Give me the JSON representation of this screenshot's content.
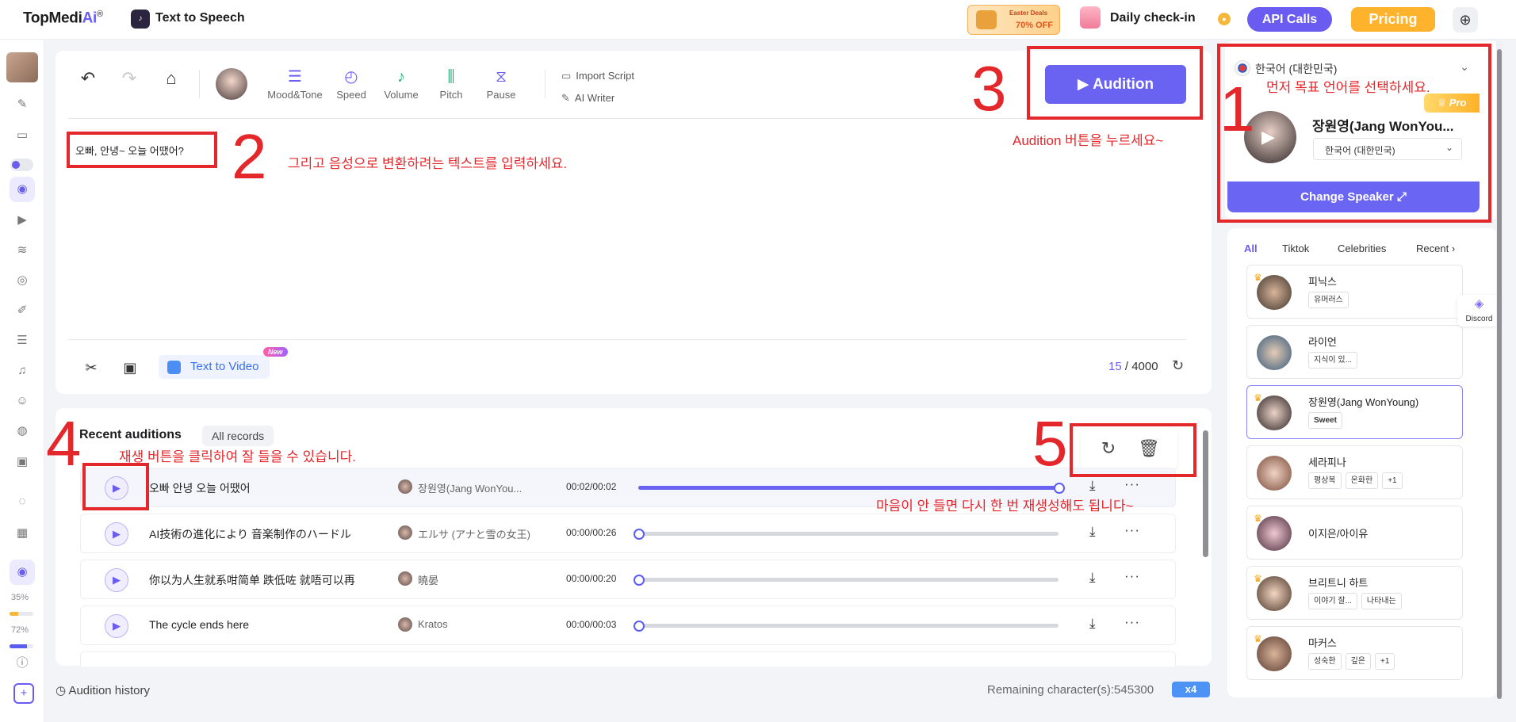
{
  "topbar": {
    "brand": "TopMedi",
    "brand_ai": "Ai",
    "brand_reg": "®",
    "tts_title": "Text to Speech",
    "promo_line1": "Easter Deals",
    "promo_line2": "70% OFF",
    "checkin": "Daily check-in",
    "api_calls": "API Calls",
    "pricing": "Pricing"
  },
  "rail": {
    "pct1": "35%",
    "pct1_value": 0.35,
    "pct2": "72%",
    "pct2_value": 0.72
  },
  "toolbar": {
    "tools": [
      "Mood&Tone",
      "Speed",
      "Volume",
      "Pitch",
      "Pause"
    ],
    "import_script": "Import Script",
    "ai_writer": "AI Writer",
    "audition": "Audition"
  },
  "editor": {
    "text": "오빠, 안녕~ 오늘 어땠어?",
    "text_to_video": "Text to Video",
    "new_badge": "New",
    "chars_used": "15",
    "chars_max": "/ 4000"
  },
  "recent": {
    "title": "Recent auditions",
    "all_records": "All records",
    "rows": [
      {
        "text": "오빠 안녕 오늘 어땠어",
        "speaker": "장원영(Jang WonYou...",
        "time": "00:02/00:02",
        "progress": 1.0
      },
      {
        "text": "AI技術の進化により 音楽制作のハードル",
        "speaker": "エルサ (アナと雪の女王)",
        "time": "00:00/00:26",
        "progress": 0.0
      },
      {
        "text": "你以为人生就系咁简单 跌低咗 就唔可以再",
        "speaker": "曉晏",
        "time": "00:00/00:20",
        "progress": 0.0
      },
      {
        "text": "The cycle ends here",
        "speaker": "Kratos",
        "time": "00:00/00:03",
        "progress": 0.0
      }
    ],
    "history": "Audition history",
    "remaining": "Remaining character(s):545300",
    "multiplier": "x4"
  },
  "right": {
    "language": "한국어 (대한민국)",
    "pro": "Pro",
    "speaker_name": "장원영(Jang WonYou...",
    "speaker_lang": "한국어 (대한민국)",
    "change_speaker": "Change Speaker",
    "tabs": [
      "All",
      "Tiktok",
      "Celebrities",
      "Recent"
    ],
    "voices": [
      {
        "name": "피닉스",
        "tags": [
          "유머러스"
        ]
      },
      {
        "name": "라이언",
        "tags": [
          "지식이 있..."
        ]
      },
      {
        "name": "장원영(Jang WonYoung)",
        "tags": [
          "Sweet"
        ]
      },
      {
        "name": "세라피나",
        "tags": [
          "평상복",
          "온화한",
          "+1"
        ]
      },
      {
        "name": "이지은/아이유",
        "tags": []
      },
      {
        "name": "브리트니 하트",
        "tags": [
          "이야기 잘...",
          "나타내는"
        ]
      },
      {
        "name": "마커스",
        "tags": [
          "성숙한",
          "깊은",
          "+1"
        ]
      }
    ],
    "discord": "Discord"
  },
  "annotations": {
    "n1": "1",
    "n2": "2",
    "n3": "3",
    "n4": "4",
    "n5": "5",
    "a1": "먼저 목표 언어를 선택하세요.",
    "a2": "그리고 음성으로 변환하려는 텍스트를 입력하세요.",
    "a3": "Audition 버튼을 누르세요~",
    "a4": "재생 버튼을 클릭하여 잘 들을 수 있습니다.",
    "a5": "마음이 안 들면 다시 한 번 재생성해도 됩니다~",
    "color": "#e3272b"
  }
}
